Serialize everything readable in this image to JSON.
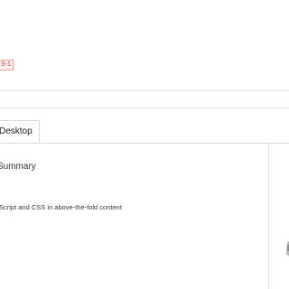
{
  "header": {
    "badge_text": "S-1"
  },
  "tabs": [
    {
      "label": "Desktop",
      "active": true
    }
  ],
  "summary": {
    "title": "Summary",
    "rules": [
      {
        "text": "Script and CSS in above-the-fold content"
      }
    ]
  },
  "icons": {
    "device_preview": "phone-preview-icon"
  },
  "colors": {
    "badge_text": "#c0392b",
    "badge_border": "#e8a8a0",
    "border": "#d9d9d9"
  }
}
